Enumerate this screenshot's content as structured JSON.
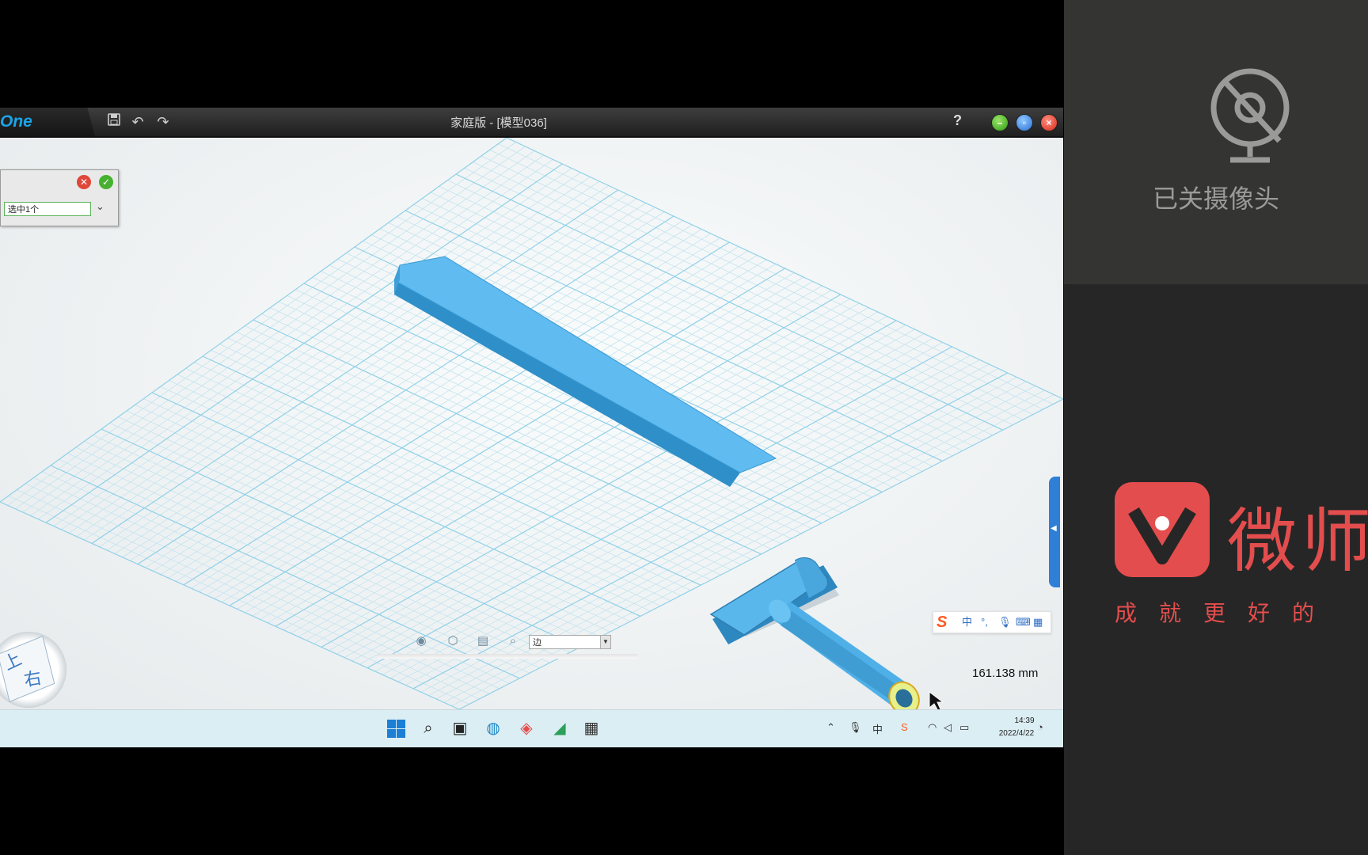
{
  "app": {
    "logo_text": "One",
    "title": "家庭版 - [模型036]",
    "help_label": "?",
    "icons": [
      "save-icon",
      "undo-icon",
      "redo-icon"
    ]
  },
  "selection_panel": {
    "field_value": "选中1个",
    "cancel_icon": "close-icon",
    "confirm_icon": "check-icon"
  },
  "viewcube": {
    "top_label": "上",
    "right_label": "右"
  },
  "view_toolbar": {
    "filter_value": "边",
    "icons": [
      "eye-icon",
      "box-icon",
      "layers-icon",
      "zoom-icon"
    ]
  },
  "measurement": "161.138 mm",
  "ime": {
    "mode": "中",
    "items": [
      "punctuation-icon",
      "microphone-icon",
      "keyboard-icon",
      "apps-icon"
    ]
  },
  "taskbar": {
    "apps": [
      "windows-start-icon",
      "search-icon",
      "task-view-icon",
      "edge-browser-icon",
      "weishi-app-icon",
      "screen-recorder-icon",
      "calculator-icon"
    ],
    "clock_time": "14:39",
    "clock_date": "2022/4/22"
  },
  "camera_panel": {
    "label": "已关摄像头"
  },
  "brand": {
    "name": "微师",
    "slogan": "成就更好的"
  },
  "colors": {
    "model_blue": "#5bb8ee",
    "grid_cyan": "#8fd0e8",
    "brand_red": "#e44d4d"
  }
}
